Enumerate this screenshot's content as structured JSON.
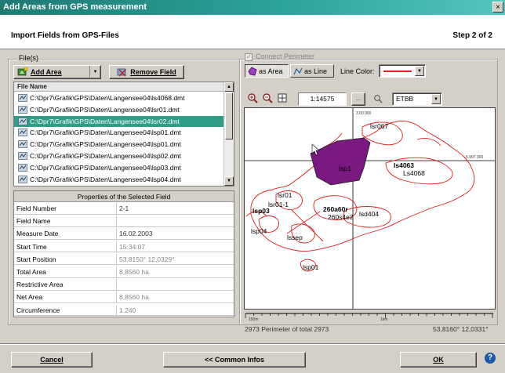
{
  "window": {
    "title": "Add Areas from GPS measurement",
    "close_label": "×"
  },
  "header": {
    "title": "Import Fields from GPS-Files",
    "step": "Step 2 of 2"
  },
  "files_group": {
    "label": "File(s)",
    "add_area_label": "Add Area",
    "remove_field_label": "Remove Field",
    "list_header": "File Name",
    "files": [
      "C:\\Dpr7\\Grafik\\GPS\\Daten\\Langensee04\\ls4068.dmt",
      "C:\\Dpr7\\Grafik\\GPS\\Daten\\Langensee04\\lsr01.dmt",
      "C:\\Dpr7\\Grafik\\GPS\\Daten\\Langensee04\\lsr02.dmt",
      "C:\\Dpr7\\Grafik\\GPS\\Daten\\Langensee04\\lsp01.dmt",
      "C:\\Dpr7\\Grafik\\GPS\\Daten\\Langensee04\\lsp01.dmt",
      "C:\\Dpr7\\Grafik\\GPS\\Daten\\Langensee04\\lsp02.dmt",
      "C:\\Dpr7\\Grafik\\GPS\\Daten\\Langensee04\\lsp03.dmt",
      "C:\\Dpr7\\Grafik\\GPS\\Daten\\Langensee04\\lsp04.dmt"
    ],
    "selected_index": 2
  },
  "properties": {
    "title": "Properties of the Selected Field",
    "rows": [
      {
        "key": "Field Number",
        "value": "2-1"
      },
      {
        "key": "Field Name",
        "value": ""
      },
      {
        "key": "Measure Date",
        "value": "16.02.2003"
      },
      {
        "key": "Start Time",
        "value": "15:34:07"
      },
      {
        "key": "Start Position",
        "value": "53,8150° 12,0329°"
      },
      {
        "key": "Total Area",
        "value": "8,8560 ha"
      },
      {
        "key": "Restrictive Area",
        "value": ""
      },
      {
        "key": "Net Area",
        "value": "8,8560 ha"
      },
      {
        "key": "Circumference",
        "value": "1.240"
      }
    ]
  },
  "map_panel": {
    "connect_perimeter_label": "Connect Perimeter",
    "as_area_label": "as Area",
    "as_line_label": "as Line",
    "line_color_label": "Line Color:",
    "line_color": "#e02020",
    "scale": "1:14575",
    "projection": "ETBB",
    "axis_top": "3.00 000",
    "axis_right": "5.997.300",
    "labels": [
      "lsr067",
      "ls4063",
      "Ls4068",
      "lsr01",
      "lsr01-1",
      "lsp03",
      "lsp04",
      "260a60r",
      "260s4e2",
      "lsd404",
      "lsp1",
      "lssep",
      "lsp01"
    ],
    "fill_color": "#7a1a80",
    "outline_color": "#e02020",
    "scale_left": "100m",
    "scale_right": "1km",
    "status_left": "2973 Perimeter of total 2973",
    "status_right": "53,8160° 12,0331°"
  },
  "footer": {
    "cancel_label": "Cancel",
    "common_infos_label": "<< Common Infos",
    "ok_label": "OK",
    "help_label": "?"
  }
}
